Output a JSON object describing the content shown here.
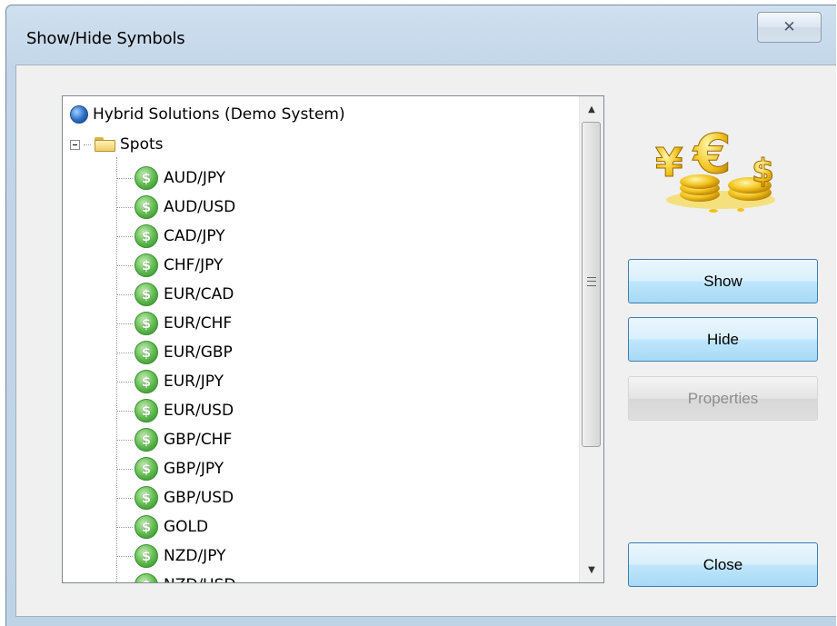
{
  "window": {
    "title": "Show/Hide Symbols",
    "close_glyph": "✕"
  },
  "tree": {
    "root_label": "Hybrid Solutions (Demo System)",
    "root_icon": "globe-icon",
    "folder_label": "Spots",
    "folder_icon": "folder-icon",
    "item_icon": "dollar-coin-icon",
    "item_glyph": "$",
    "items": [
      "AUD/JPY",
      "AUD/USD",
      "CAD/JPY",
      "CHF/JPY",
      "EUR/CAD",
      "EUR/CHF",
      "EUR/GBP",
      "EUR/JPY",
      "EUR/USD",
      "GBP/CHF",
      "GBP/JPY",
      "GBP/USD",
      "GOLD",
      "NZD/JPY",
      "NZD/USD"
    ],
    "scroll_up_glyph": "▲",
    "scroll_down_glyph": "▼"
  },
  "buttons": {
    "show": "Show",
    "hide": "Hide",
    "properties": "Properties",
    "close": "Close"
  },
  "colors": {
    "accent_border": "#3c7fb1",
    "button_fill": "#bee6fd",
    "disabled_text": "#8d8d8d",
    "coin_green": "#5cb84a",
    "gold": "#f2c21b"
  }
}
